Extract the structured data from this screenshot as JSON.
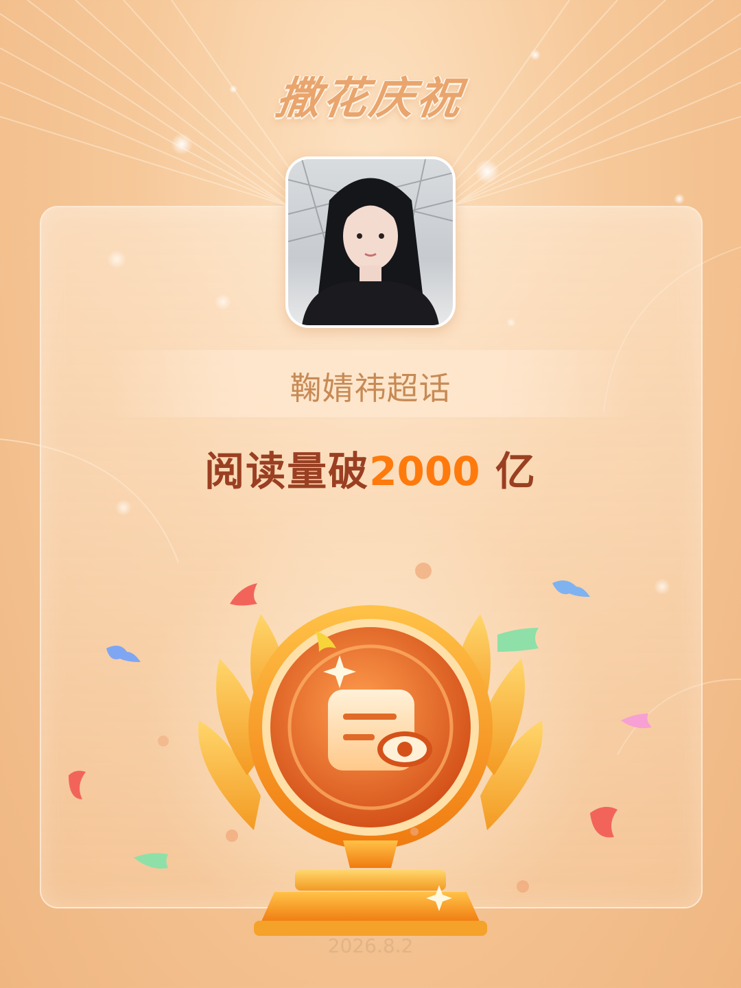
{
  "banner": {
    "title": "撒花庆祝"
  },
  "topic": {
    "name": "鞠婧祎超话"
  },
  "milestone": {
    "prefix": "阅读量破",
    "number": "2000",
    "unit": "亿"
  },
  "date": "2026.8.2",
  "icons": {
    "avatar": "user-avatar-photo",
    "trophy": "trophy-read-icon"
  },
  "colors": {
    "background": "#f6c899",
    "title": "#e9a56d",
    "milestone_text": "#9a3f22",
    "milestone_number": "#ff7a0c",
    "trophy_gold": "#f7a73a",
    "trophy_core": "#e8682a"
  }
}
